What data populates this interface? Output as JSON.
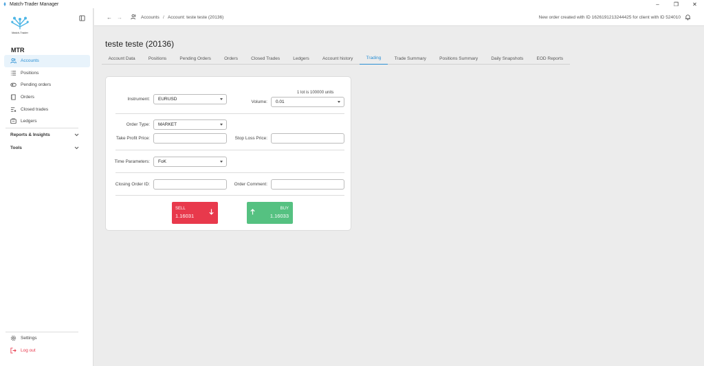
{
  "window": {
    "title": "Match-Trader Manager"
  },
  "sidebar": {
    "logo_text": "Match-Trader",
    "org": "MTR",
    "items": [
      {
        "label": "Accounts",
        "icon": "users-icon",
        "active": true
      },
      {
        "label": "Positions",
        "icon": "list-icon",
        "active": false
      },
      {
        "label": "Pending orders",
        "icon": "pending-icon",
        "active": false
      },
      {
        "label": "Orders",
        "icon": "orders-icon",
        "active": false
      },
      {
        "label": "Closed trades",
        "icon": "closed-trades-icon",
        "active": false
      },
      {
        "label": "Ledgers",
        "icon": "ledger-icon",
        "active": false
      }
    ],
    "groups": [
      {
        "label": "Reports & Insights"
      },
      {
        "label": "Tools"
      }
    ],
    "settings_label": "Settings",
    "logout_label": "Log out"
  },
  "header": {
    "breadcrumb": [
      "Accounts",
      "/",
      "Account: teste teste (20136)"
    ],
    "notification": "New order created with ID 1626191213244425 for client with ID 524010"
  },
  "page": {
    "title": "teste teste (20136)",
    "tabs": [
      "Account Data",
      "Positions",
      "Pending Orders",
      "Orders",
      "Closed Trades",
      "Ledgers",
      "Account history",
      "Trading",
      "Trade Summary",
      "Positions Summary",
      "Daily Snapshots",
      "EOD Reports"
    ],
    "active_tab": "Trading"
  },
  "form": {
    "instrument_label": "Instrument:",
    "instrument_value": "EURUSD",
    "lot_note": "1 lot is 100000 units",
    "volume_label": "Volume:",
    "volume_value": "0.01",
    "order_type_label": "Order Type:",
    "order_type_value": "MARKET",
    "take_profit_label": "Take Profit Price:",
    "stop_loss_label": "Stop Loss Price:",
    "time_params_label": "Time Parameters:",
    "time_params_value": "FoK",
    "closing_order_label": "Closing Order ID:",
    "order_comment_label": "Order Comment:"
  },
  "trade": {
    "sell_label": "SELL",
    "sell_price": "1.16031",
    "buy_label": "BUY",
    "buy_price": "1.16033"
  },
  "colors": {
    "accent": "#2a8fd4",
    "sell": "#e8394c",
    "buy": "#55c181"
  }
}
